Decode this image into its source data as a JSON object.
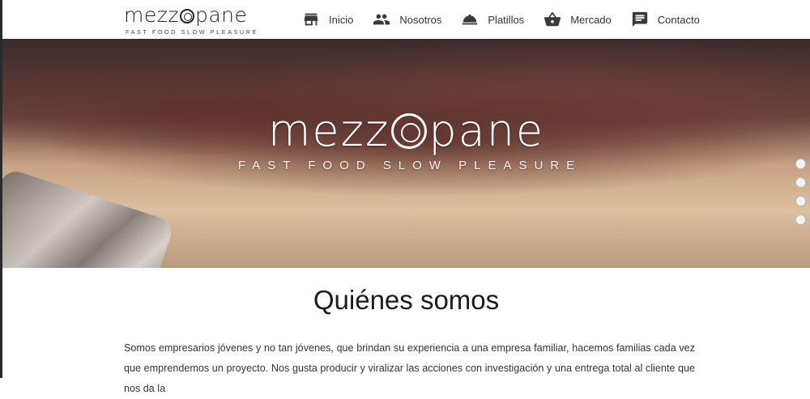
{
  "brand": {
    "name_left": "mezz",
    "name_right": "pane",
    "tagline": "FAST FOOD SLOW PLEASURE"
  },
  "nav": {
    "items": [
      {
        "label": "Inicio",
        "icon": "store-icon"
      },
      {
        "label": "Nosotros",
        "icon": "people-icon"
      },
      {
        "label": "Platillos",
        "icon": "cloche-icon"
      },
      {
        "label": "Mercado",
        "icon": "basket-icon"
      },
      {
        "label": "Contacto",
        "icon": "chat-icon"
      }
    ]
  },
  "hero": {
    "name_left": "mezz",
    "name_right": "pane",
    "tagline": "FAST FOOD SLOW PLEASURE",
    "slides": 4
  },
  "about": {
    "title": "Quiénes somos",
    "body": "Somos empresarios jóvenes y no tan jóvenes, que brindan su experiencia a una empresa familiar, hacemos familias cada vez que emprendemos un proyecto. Nos gusta producir y viralizar las acciones con investigación y una entrega total al cliente que nos da la"
  },
  "colors": {
    "text": "#222222",
    "icon": "#3a3a3a",
    "background": "#ffffff"
  }
}
